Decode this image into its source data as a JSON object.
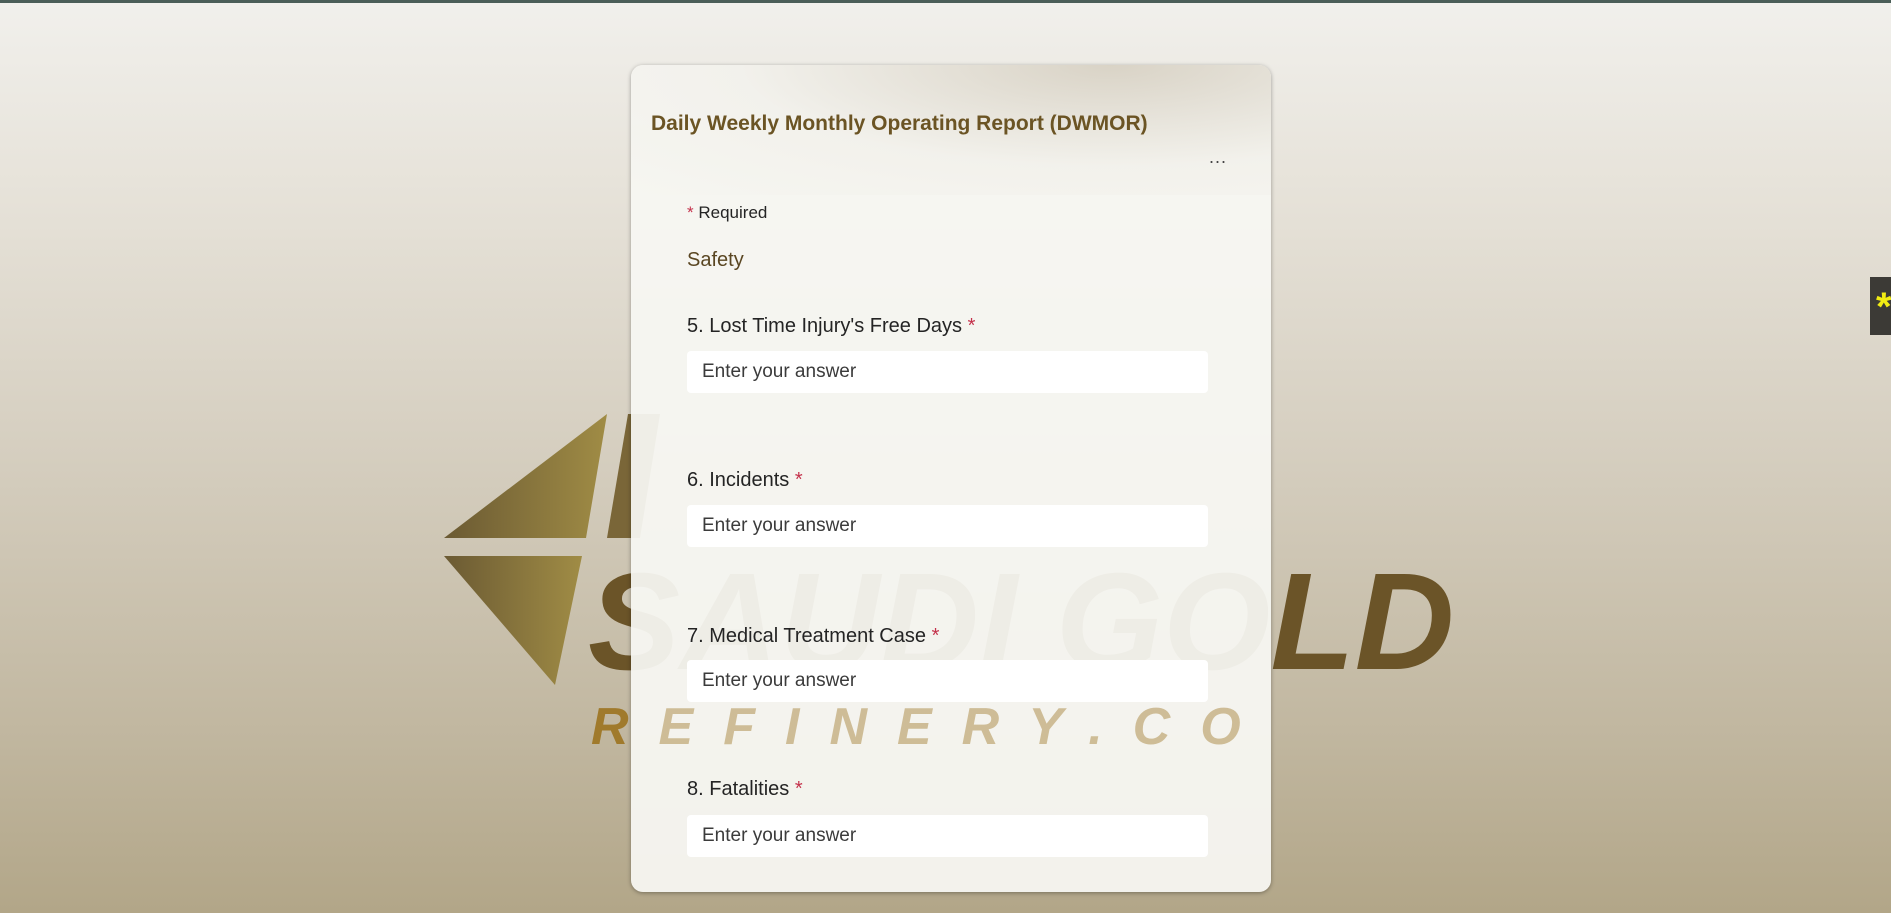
{
  "form": {
    "title": "Daily Weekly Monthly Operating Report (DWMOR)",
    "more_label": "...",
    "required_star": "*",
    "required_label": "Required",
    "section_title": "Safety",
    "questions": [
      {
        "label": "5. Lost Time Injury's Free Days",
        "required": "*",
        "placeholder": "Enter your answer"
      },
      {
        "label": "6. Incidents",
        "required": "*",
        "placeholder": "Enter your answer"
      },
      {
        "label": "7. Medical Treatment Case",
        "required": "*",
        "placeholder": "Enter your answer"
      },
      {
        "label": "8. Fatalities",
        "required": "*",
        "placeholder": "Enter your answer"
      }
    ]
  },
  "background": {
    "logo_text": "SAUDI GOLD",
    "logo_subtext": "REFINERY.CO"
  },
  "widget": {
    "icon": "asterisk-icon",
    "glyph": "*"
  },
  "colors": {
    "title": "#6b5424",
    "required": "#c4314b",
    "logo": "#6b5428"
  }
}
